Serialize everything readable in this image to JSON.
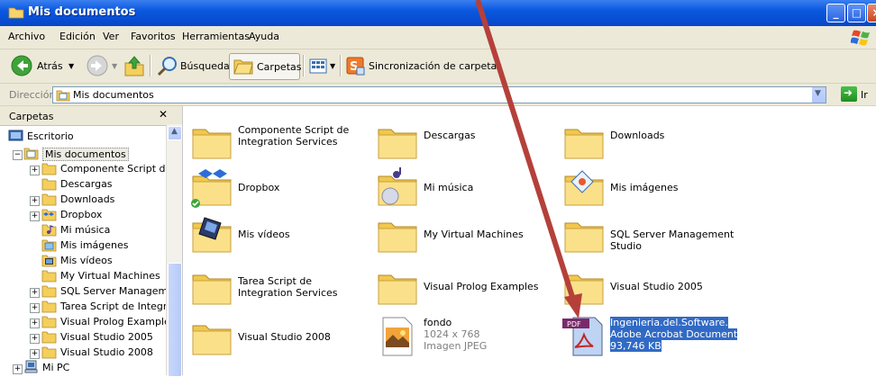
{
  "window": {
    "title": "Mis documentos"
  },
  "menu": [
    "Archivo",
    "Edición",
    "Ver",
    "Favoritos",
    "Herramientas",
    "Ayuda"
  ],
  "toolbar": {
    "back_label": "Atrás",
    "search_label": "Búsqueda",
    "folders_label": "Carpetas",
    "sync_label": "Sincronización de carpetas"
  },
  "address": {
    "label": "Dirección",
    "value": "Mis documentos",
    "go_label": "Ir"
  },
  "folder_pane": {
    "title": "Carpetas",
    "items": [
      {
        "label": "Escritorio",
        "icon": "desktop-icon"
      },
      {
        "label": "Mis documentos",
        "icon": "my-documents-icon"
      },
      {
        "label": "Componente Script de Integration Services",
        "icon": "folder-icon"
      },
      {
        "label": "Descargas",
        "icon": "folder-icon"
      },
      {
        "label": "Downloads",
        "icon": "folder-icon"
      },
      {
        "label": "Dropbox",
        "icon": "dropbox-folder-icon"
      },
      {
        "label": "Mi música",
        "icon": "music-folder-icon"
      },
      {
        "label": "Mis imágenes",
        "icon": "pictures-folder-icon"
      },
      {
        "label": "Mis vídeos",
        "icon": "videos-folder-icon"
      },
      {
        "label": "My Virtual Machines",
        "icon": "folder-icon"
      },
      {
        "label": "SQL Server Management Studio",
        "icon": "folder-icon"
      },
      {
        "label": "Tarea Script de Integration Services",
        "icon": "folder-icon"
      },
      {
        "label": "Visual Prolog Examples",
        "icon": "folder-icon"
      },
      {
        "label": "Visual Studio 2005",
        "icon": "folder-icon"
      },
      {
        "label": "Visual Studio 2008",
        "icon": "folder-icon"
      },
      {
        "label": "Mi PC",
        "icon": "my-computer-icon"
      }
    ]
  },
  "files": [
    {
      "name": "Componente Script de Integration Services",
      "icon": "folder-icon"
    },
    {
      "name": "Descargas",
      "icon": "folder-icon"
    },
    {
      "name": "Downloads",
      "icon": "folder-icon"
    },
    {
      "name": "Dropbox",
      "icon": "dropbox-folder-icon"
    },
    {
      "name": "Mi música",
      "icon": "music-folder-icon"
    },
    {
      "name": "Mis imágenes",
      "icon": "pictures-folder-icon"
    },
    {
      "name": "Mis vídeos",
      "icon": "videos-folder-icon"
    },
    {
      "name": "My Virtual Machines",
      "icon": "folder-icon"
    },
    {
      "name": "SQL Server Management Studio",
      "icon": "folder-icon"
    },
    {
      "name": "Tarea Script de Integration Services",
      "icon": "folder-icon"
    },
    {
      "name": "Visual Prolog Examples",
      "icon": "folder-icon"
    },
    {
      "name": "Visual Studio 2005",
      "icon": "folder-icon"
    },
    {
      "name": "Visual Studio 2008",
      "icon": "folder-icon"
    },
    {
      "name": "fondo",
      "details": [
        "1024 x 768",
        "Imagen JPEG"
      ],
      "icon": "jpeg-image-icon"
    },
    {
      "name": "Ingenieria.del.Software.",
      "details": [
        "Adobe Acrobat Document",
        "93,746 KB"
      ],
      "icon": "pdf-file-icon",
      "selected": true
    }
  ],
  "colors": {
    "titlebar": "#0a58e0",
    "selection": "#316ac5",
    "annotation_arrow": "#b5403a",
    "folder": "#f9d96b"
  }
}
